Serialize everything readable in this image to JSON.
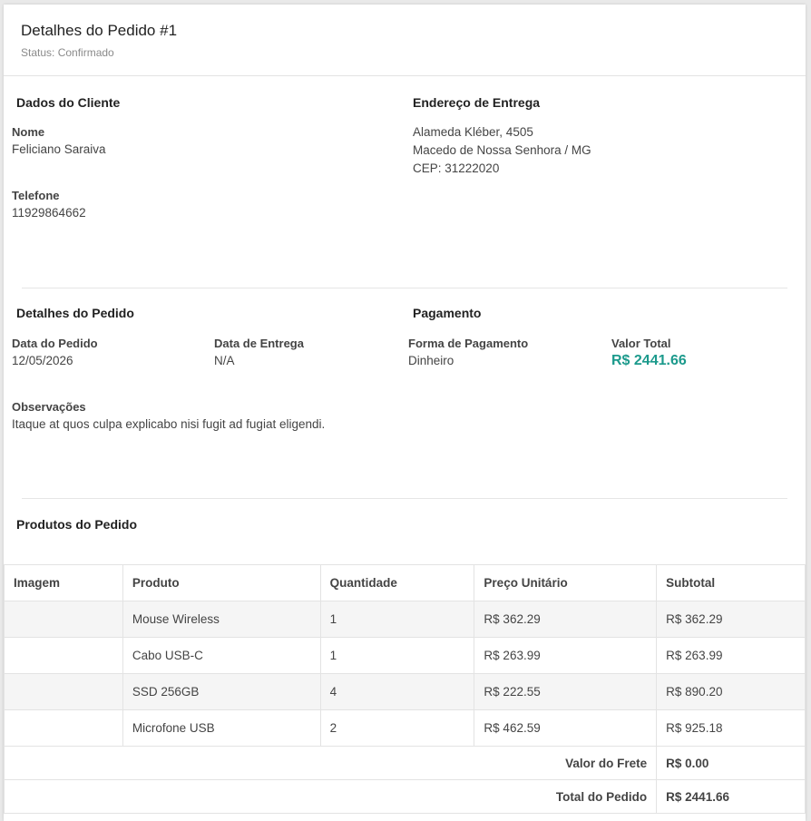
{
  "header": {
    "title": "Detalhes do Pedido #1",
    "status": "Status: Confirmado"
  },
  "customer": {
    "section_title": "Dados do Cliente",
    "name_label": "Nome",
    "name_value": "Feliciano Saraiva",
    "phone_label": "Telefone",
    "phone_value": "11929864662"
  },
  "address": {
    "section_title": "Endereço de Entrega",
    "line1": "Alameda Kléber, 4505",
    "line2": "Macedo de Nossa Senhora / MG",
    "line3": "CEP: 31222020"
  },
  "order": {
    "section_title": "Detalhes do Pedido",
    "date_label": "Data do Pedido",
    "date_value": "12/05/2026",
    "delivery_label": "Data de Entrega",
    "delivery_value": "N/A",
    "notes_label": "Observações",
    "notes_value": "Itaque at quos culpa explicabo nisi fugit ad fugiat eligendi."
  },
  "payment": {
    "section_title": "Pagamento",
    "method_label": "Forma de Pagamento",
    "method_value": "Dinheiro",
    "total_label": "Valor Total",
    "total_value": "R$ 2441.66",
    "accent_color": "#1c9a8c"
  },
  "products": {
    "section_title": "Produtos do Pedido",
    "columns": [
      "Imagem",
      "Produto",
      "Quantidade",
      "Preço Unitário",
      "Subtotal"
    ],
    "rows": [
      {
        "image": "",
        "product": "Mouse Wireless",
        "quantity": "1",
        "unit_price": "R$ 362.29",
        "subtotal": "R$ 362.29"
      },
      {
        "image": "",
        "product": "Cabo USB-C",
        "quantity": "1",
        "unit_price": "R$ 263.99",
        "subtotal": "R$ 263.99"
      },
      {
        "image": "",
        "product": "SSD 256GB",
        "quantity": "4",
        "unit_price": "R$ 222.55",
        "subtotal": "R$ 890.20"
      },
      {
        "image": "",
        "product": "Microfone USB",
        "quantity": "2",
        "unit_price": "R$ 462.59",
        "subtotal": "R$ 925.18"
      }
    ],
    "shipping_label": "Valor do Frete",
    "shipping_value": "R$ 0.00",
    "total_label": "Total do Pedido",
    "total_value": "R$ 2441.66"
  }
}
